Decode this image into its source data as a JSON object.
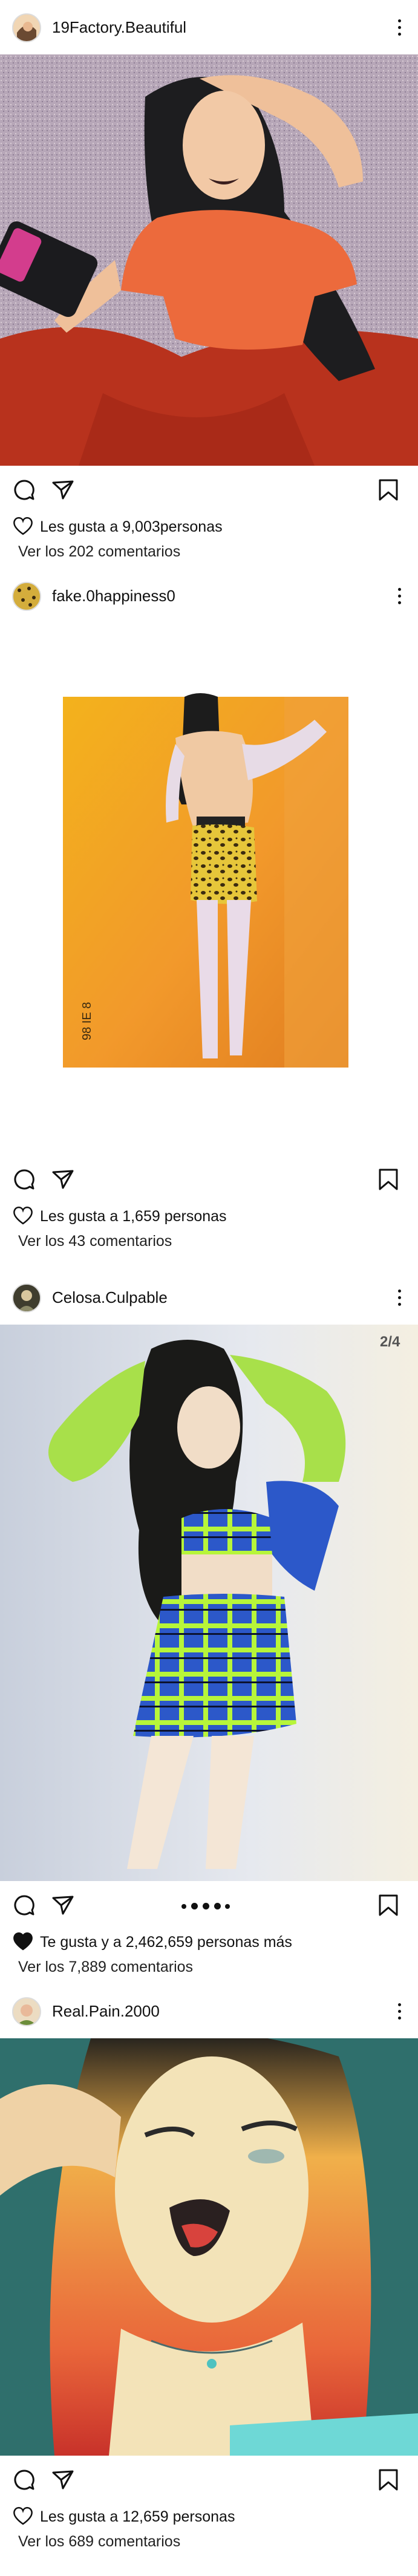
{
  "posts": [
    {
      "username": "19Factory.Beautiful",
      "likes_text": "Les gusta a 9,003personas",
      "comments_text": "Ver los 202 comentarios",
      "liked": false
    },
    {
      "username": "fake.0happiness0",
      "likes_text": "Les gusta a 1,659 personas",
      "comments_text": "Ver los 43 comentarios",
      "photo_stamp": "98 IE 8",
      "liked": false
    },
    {
      "username": "Celosa.Culpable",
      "likes_text": "Te gusta y a 2,462,659 personas más",
      "comments_text": "Ver los 7,889 comentarios",
      "image_counter": "2/4",
      "liked": true
    },
    {
      "username": "Real.Pain.2000",
      "likes_text": "Les gusta a 12,659 personas",
      "comments_text": "Ver los 689 comentarios",
      "liked": false
    }
  ],
  "icons": {
    "comment": "comment-icon",
    "share": "share-icon",
    "save": "bookmark-icon",
    "like": "heart-icon",
    "more": "more-options-icon"
  },
  "colors": {
    "liked_heart": "#111111",
    "text": "#111111"
  }
}
